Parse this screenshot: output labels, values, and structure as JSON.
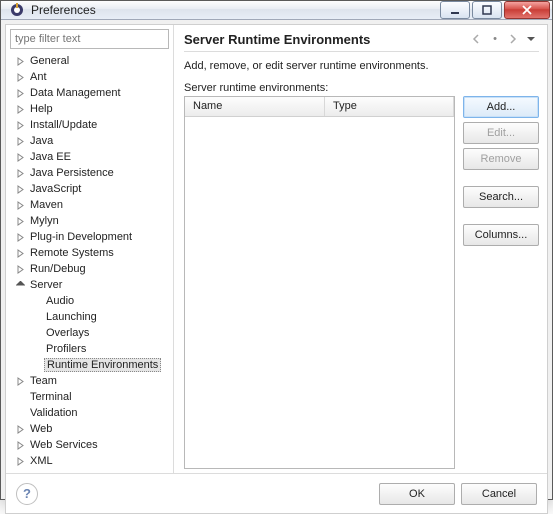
{
  "window": {
    "title": "Preferences"
  },
  "sidebar": {
    "filter_placeholder": "type filter text",
    "items": [
      {
        "label": "General",
        "expanded": false,
        "depth": 0
      },
      {
        "label": "Ant",
        "expanded": false,
        "depth": 0
      },
      {
        "label": "Data Management",
        "expanded": false,
        "depth": 0
      },
      {
        "label": "Help",
        "expanded": false,
        "depth": 0
      },
      {
        "label": "Install/Update",
        "expanded": false,
        "depth": 0
      },
      {
        "label": "Java",
        "expanded": false,
        "depth": 0
      },
      {
        "label": "Java EE",
        "expanded": false,
        "depth": 0
      },
      {
        "label": "Java Persistence",
        "expanded": false,
        "depth": 0
      },
      {
        "label": "JavaScript",
        "expanded": false,
        "depth": 0
      },
      {
        "label": "Maven",
        "expanded": false,
        "depth": 0
      },
      {
        "label": "Mylyn",
        "expanded": false,
        "depth": 0
      },
      {
        "label": "Plug-in Development",
        "expanded": false,
        "depth": 0
      },
      {
        "label": "Remote Systems",
        "expanded": false,
        "depth": 0
      },
      {
        "label": "Run/Debug",
        "expanded": false,
        "depth": 0
      },
      {
        "label": "Server",
        "expanded": true,
        "depth": 0
      },
      {
        "label": "Audio",
        "depth": 1
      },
      {
        "label": "Launching",
        "depth": 1
      },
      {
        "label": "Overlays",
        "depth": 1
      },
      {
        "label": "Profilers",
        "depth": 1
      },
      {
        "label": "Runtime Environments",
        "depth": 1,
        "selected": true
      },
      {
        "label": "Team",
        "expanded": false,
        "depth": 0
      },
      {
        "label": "Terminal",
        "depth": 0
      },
      {
        "label": "Validation",
        "depth": 0
      },
      {
        "label": "Web",
        "expanded": false,
        "depth": 0
      },
      {
        "label": "Web Services",
        "expanded": false,
        "depth": 0
      },
      {
        "label": "XML",
        "expanded": false,
        "depth": 0
      }
    ]
  },
  "main": {
    "heading": "Server Runtime Environments",
    "description": "Add, remove, or edit server runtime environments.",
    "table_label": "Server runtime environments:",
    "columns": {
      "name": "Name",
      "type": "Type"
    },
    "rows": []
  },
  "buttons": {
    "add": "Add...",
    "edit": "Edit...",
    "remove": "Remove",
    "search": "Search...",
    "columns": "Columns...",
    "ok": "OK",
    "cancel": "Cancel"
  }
}
